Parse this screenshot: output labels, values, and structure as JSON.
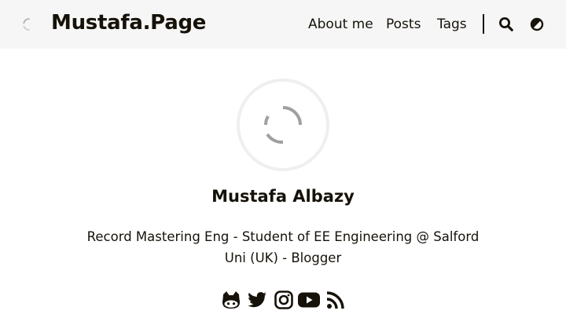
{
  "site": {
    "title": "Mustafa.Page"
  },
  "nav": {
    "items": [
      {
        "label": "About me"
      },
      {
        "label": "Posts"
      },
      {
        "label": "Tags"
      }
    ],
    "icons": [
      "search-icon",
      "theme-toggle-icon"
    ]
  },
  "profile": {
    "name": "Mustafa Albazy",
    "bio": "Record Mastering Eng - Student of EE Engineering @ Salford Uni (UK) - Blogger",
    "avatar_state": "loading"
  },
  "social": {
    "icons": [
      "github-icon",
      "twitter-icon",
      "instagram-icon",
      "youtube-icon",
      "rss-icon"
    ]
  },
  "colors": {
    "text": "#161209",
    "navbar_bg": "#f6f6f6",
    "spinner": "#a0a0a0",
    "avatar_ring": "#efefef"
  }
}
